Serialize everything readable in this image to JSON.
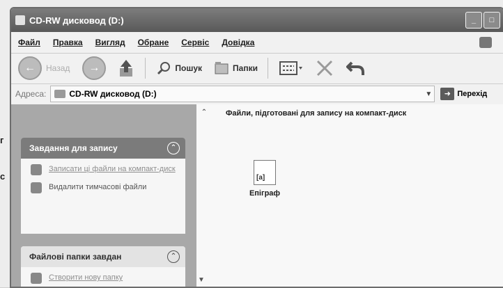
{
  "window": {
    "title": "CD-RW дисковод (D:)",
    "buttons": {
      "minimize": "_",
      "maximize": "□"
    }
  },
  "menu": {
    "items": [
      "Файл",
      "Правка",
      "Вигляд",
      "Обране",
      "Сервіс",
      "Довідка"
    ]
  },
  "toolbar": {
    "back_label": "Назад",
    "search_label": "Пошук",
    "folders_label": "Папки"
  },
  "address": {
    "label": "Адреса:",
    "value": "CD-RW дисковод (D:)",
    "go_label": "Перехід"
  },
  "tasks": {
    "write_panel": {
      "title": "Завдання для запису",
      "items": [
        {
          "label": "Записати ці файли на компакт-диск"
        },
        {
          "label": "Видалити тимчасові файли"
        }
      ]
    },
    "file_panel": {
      "title": "Файлові папки завдан",
      "items": [
        {
          "label": "Створити нову папку"
        }
      ]
    }
  },
  "content": {
    "group_title": "Файли, підготовані для запису на компакт-диск",
    "files": [
      {
        "name": "Епіграф",
        "badge": "[a]"
      }
    ]
  },
  "background": {
    "edge_letters": [
      "г",
      "с"
    ]
  }
}
